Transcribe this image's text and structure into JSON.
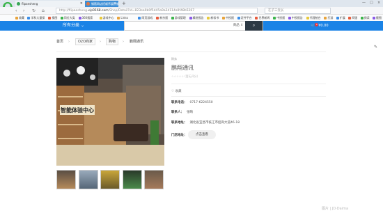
{
  "browser": {
    "tabs": [
      {
        "label": "flipaesheng",
        "close": "×"
      },
      {
        "label": "钢筋网店招顺序展例钢",
        "close": "×"
      }
    ],
    "new_tab": "+",
    "window_controls": [
      "—",
      "□",
      "×"
    ],
    "nav": {
      "back": "‹",
      "forward": "›",
      "reload": "↻",
      "home": "⌂"
    },
    "url": {
      "prefix": "http://flipaesheng.",
      "domain": "vip9168.com",
      "path": "/Shop/Detail?id=823ea9b0f5d45a9a2d114a9f48b5267"
    },
    "search_placeholder": "在子三受长",
    "bookmarks": [
      "收藏",
      "学科大量保",
      "搜图",
      "同位大类",
      "360搜索",
      "游戏中心",
      "Linko",
      "网页游戏",
      "新京报",
      "游戏管理",
      "精进报告",
      "新标书",
      "中投报",
      "证件平台",
      "世界新闻",
      "中投报",
      "中投报告",
      "代理统台",
      "打游",
      "扩展",
      "网银",
      "阅读",
      "截图",
      "翻译"
    ]
  },
  "site": {
    "category_button": "所有分类",
    "search_type": "商品",
    "search_button": "⌕",
    "cart_count": "0",
    "cart_total": "¥0.00"
  },
  "breadcrumb": [
    "首页",
    "O2O商家",
    "购物",
    "鹏翔通讯"
  ],
  "store": {
    "top_tag": "财务",
    "title": "鹏翔通讯",
    "rating_text": "(暂无评分)",
    "favorite_label": "♡ 收藏",
    "phone_label": "联系电话：",
    "phone": "0717-6224550",
    "contact_label": "联系人：",
    "contact": "张晴",
    "address_label": "联系地址：",
    "address": "湖北省宜昌市枝江市招商大道46-18",
    "map_label": "门店地址：",
    "map_button": "点击查看",
    "sign_text": "智能体验中心"
  },
  "watermark": "图片 | JD·Daima",
  "colors": {
    "accent": "#1a83e6",
    "search_btn": "#2d3a45",
    "browser_tab_active": "#3c8ed6"
  }
}
